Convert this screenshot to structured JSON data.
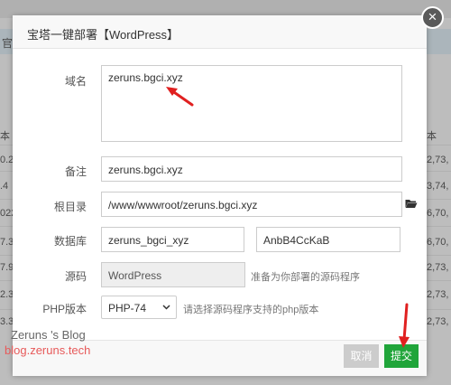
{
  "dialog": {
    "title": "宝塔一键部署【WordPress】",
    "close_glyph": "×",
    "labels": {
      "domain": "域名",
      "remark": "备注",
      "root": "根目录",
      "database": "数据库",
      "source": "源码",
      "php": "PHP版本"
    },
    "domain_value": "zeruns.bgci.xyz",
    "remark_value": "zeruns.bgci.xyz",
    "root_value": "/www/wwwroot/zeruns.bgci.xyz",
    "db_name": "zeruns_bgci_xyz",
    "db_password": "AnbB4CcKaB",
    "source_value": "WordPress",
    "source_hint": "准备为你部署的源码程序",
    "php_value": "PHP-74",
    "php_hint": "请选择源码程序支持的php版本",
    "cancel_label": "取消",
    "submit_label": "提交"
  },
  "background": {
    "header_fragment": "官",
    "col_left_header": "本",
    "col_right_header": "本",
    "left_fragments": [
      "0.2",
      ".4",
      "022",
      "7.3",
      "7.9",
      "2.3",
      "3.3"
    ],
    "right_fragments": [
      "2,73,",
      "3,74,",
      "6,70,",
      "6,70,",
      "2,73,",
      "2,73,",
      "2,73,"
    ]
  },
  "watermark": {
    "line1": "Zeruns 's Blog",
    "line2": "blog.zeruns.tech"
  },
  "colors": {
    "submit": "#20a53a",
    "cancel": "#cccccc",
    "arrow": "#e02020",
    "watermark_url": "#e75a5a"
  },
  "icons": {
    "folder": "folder-open-icon",
    "close": "close-icon",
    "dropdown": "chevron-down-icon"
  }
}
